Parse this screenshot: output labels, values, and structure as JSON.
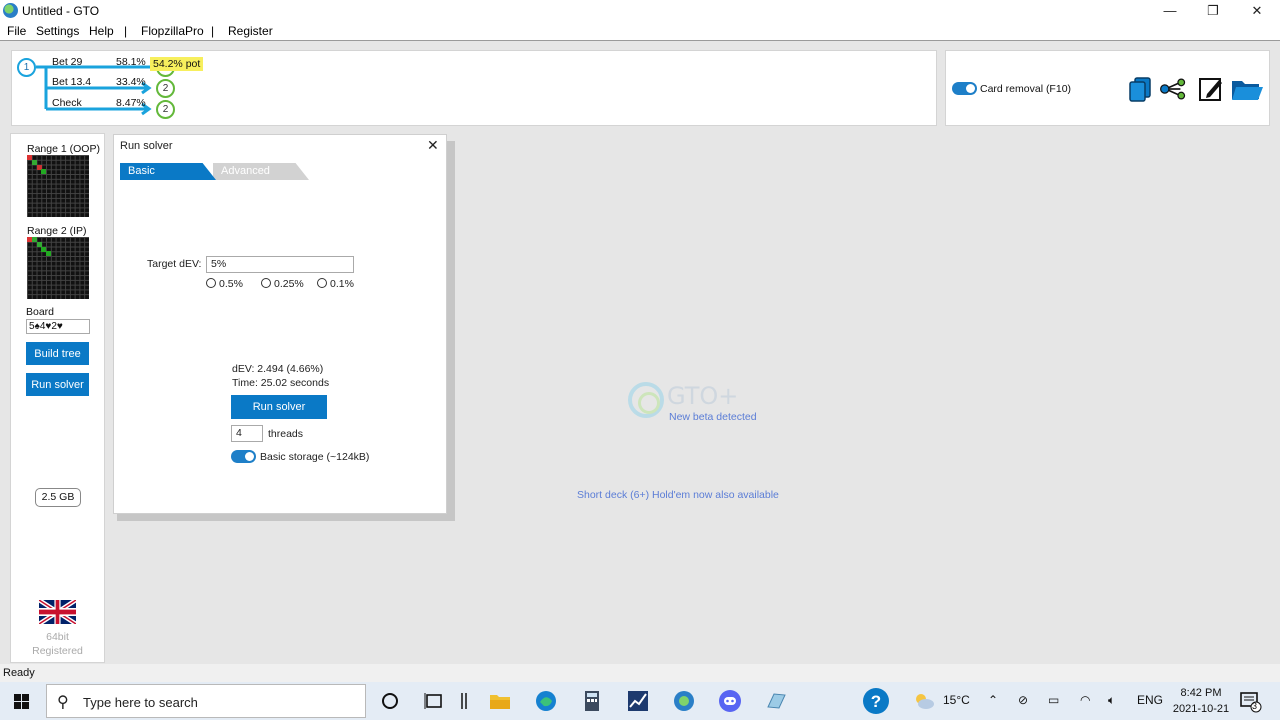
{
  "window": {
    "title": "Untitled - GTO",
    "min_glyph": "—",
    "max_glyph": "❐",
    "close_glyph": "✕"
  },
  "menu": {
    "items": [
      "File",
      "Settings",
      "Help",
      "FlopzillaPro",
      "Register"
    ],
    "separator": "|"
  },
  "tree": {
    "root_node": "1",
    "branches": [
      {
        "label": "Bet 29",
        "pct": "58.1%",
        "node": "2"
      },
      {
        "label": "Bet 13.4",
        "pct": "33.4%",
        "node": "2"
      },
      {
        "label": "Check",
        "pct": "8.47%",
        "node": "2"
      }
    ],
    "pot_tooltip": "54.2% pot"
  },
  "tools": {
    "card_removal_label": "Card removal (F10)",
    "card_removal_on": true
  },
  "sidebar": {
    "range1_label": "Range 1 (OOP)",
    "range2_label": "Range 2 (IP)",
    "board_label": "Board",
    "board_value": "5♠4♥2♥",
    "build_tree_label": "Build tree",
    "run_solver_label": "Run solver",
    "memory": "2.5 GB",
    "bitness": "64bit",
    "registration": "Registered"
  },
  "dialog": {
    "title": "Run solver",
    "close_glyph": "✕",
    "tabs": [
      "Basic",
      "Advanced"
    ],
    "active_tab": "Basic",
    "target_dev_label": "Target dEV:",
    "target_dev_value": "5%",
    "dev_options": [
      "0.5%",
      "0.25%",
      "0.1%"
    ],
    "dev_result": "dEV: 2.494 (4.66%)",
    "time_result": "Time: 25.02 seconds",
    "run_button": "Run solver",
    "threads_value": "4",
    "threads_label": "threads",
    "storage_label": "Basic storage (~124kB)",
    "storage_on": true
  },
  "center": {
    "logo_text": "GTO+",
    "beta_notice": "New beta detected",
    "short_deck_notice": "Short deck (6+) Hold'em now also available"
  },
  "status": {
    "text": "Ready"
  },
  "taskbar": {
    "search_placeholder": "Type here to search",
    "temperature": "15°C",
    "language": "ENG",
    "time": "8:42 PM",
    "date": "2021-10-21",
    "notification_count": "3"
  },
  "colors": {
    "accent": "#0a79c6",
    "tree_line": "#1aa3dd",
    "node_green": "#63b83a",
    "link": "#5b7dd6",
    "tooltip": "#f7ef5d"
  }
}
